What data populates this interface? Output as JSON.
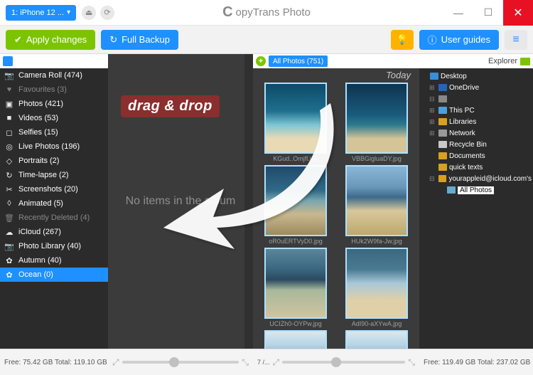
{
  "titlebar": {
    "device": "1: iPhone 12 ...",
    "app_name_prefix": "C",
    "app_name_rest": "opyTrans Photo"
  },
  "actions": {
    "apply": "Apply changes",
    "backup": "Full Backup",
    "guides": "User guides"
  },
  "sidebar": {
    "items": [
      {
        "icon": "📷",
        "label": "Camera Roll (474)"
      },
      {
        "icon": "♥",
        "label": "Favourites (3)",
        "dim": true
      },
      {
        "icon": "▣",
        "label": "Photos (421)"
      },
      {
        "icon": "■",
        "label": "Videos (53)"
      },
      {
        "icon": "◻",
        "label": "Selfies (15)"
      },
      {
        "icon": "◎",
        "label": "Live Photos (196)"
      },
      {
        "icon": "◇",
        "label": "Portraits (2)"
      },
      {
        "icon": "↻",
        "label": "Time-lapse (2)"
      },
      {
        "icon": "✂",
        "label": "Screenshots (20)"
      },
      {
        "icon": "◊",
        "label": "Animated (5)"
      },
      {
        "icon": "🗑",
        "label": "Recently Deleted (4)",
        "dim": true
      },
      {
        "icon": "☁",
        "label": "iCloud (267)"
      },
      {
        "icon": "📷",
        "label": "Photo Library (40)"
      },
      {
        "icon": "✿",
        "label": "Autumn (40)"
      },
      {
        "icon": "✿",
        "label": "Ocean (0)",
        "sel": true
      }
    ]
  },
  "album": {
    "empty_text": "No items in the album",
    "overlay": "drag & drop"
  },
  "grid": {
    "pill": "All Photos (751)",
    "today": "Today",
    "thumbs": [
      {
        "file": "KGud..Omjfl.jpg",
        "cls": "wave"
      },
      {
        "file": "VBBGigluaDY.jpg",
        "cls": "wave2"
      },
      {
        "file": "oR0uERTVyD0.jpg",
        "cls": "wave3"
      },
      {
        "file": "HUk2W9fa-Jw.jpg",
        "cls": "wave4"
      },
      {
        "file": "UCIZh0-OYPw.jpg",
        "cls": "wave5"
      },
      {
        "file": "AdI90-aXYwA.jpg",
        "cls": "wave6"
      },
      {
        "file": "",
        "cls": "wave7",
        "small": true
      },
      {
        "file": "",
        "cls": "wave7",
        "small": true
      }
    ],
    "page": "7 /..."
  },
  "explorer": {
    "title": "Explorer",
    "tree": [
      {
        "level": 1,
        "exp": "",
        "icn": "desktop-icn",
        "label": "Desktop"
      },
      {
        "level": 2,
        "exp": "⊞",
        "icn": "onedrive-icn",
        "label": "OneDrive"
      },
      {
        "level": 2,
        "exp": "⊟",
        "icn": "usr-icn",
        "label": ""
      },
      {
        "level": 2,
        "exp": "⊞",
        "icn": "pc-icn",
        "label": "This PC"
      },
      {
        "level": 2,
        "exp": "⊞",
        "icn": "lib-icn",
        "label": "Libraries"
      },
      {
        "level": 2,
        "exp": "⊞",
        "icn": "net-icn",
        "label": "Network"
      },
      {
        "level": 2,
        "exp": "",
        "icn": "rec-icn",
        "label": "Recycle Bin"
      },
      {
        "level": 2,
        "exp": "",
        "icn": "folder-icn",
        "label": "Documents"
      },
      {
        "level": 2,
        "exp": "",
        "icn": "folder-icn",
        "label": "quick texts"
      },
      {
        "level": 2,
        "exp": "⊟",
        "icn": "folder-icn",
        "label": "yourappleid@icloud.com's"
      },
      {
        "level": 3,
        "exp": "",
        "icn": "photos-icn",
        "label": "All Photos",
        "selected": true
      }
    ]
  },
  "footer": {
    "left": "Free: 75.42 GB Total: 119.10 GB",
    "right": "Free: 119.49 GB Total: 237.02 GB"
  }
}
